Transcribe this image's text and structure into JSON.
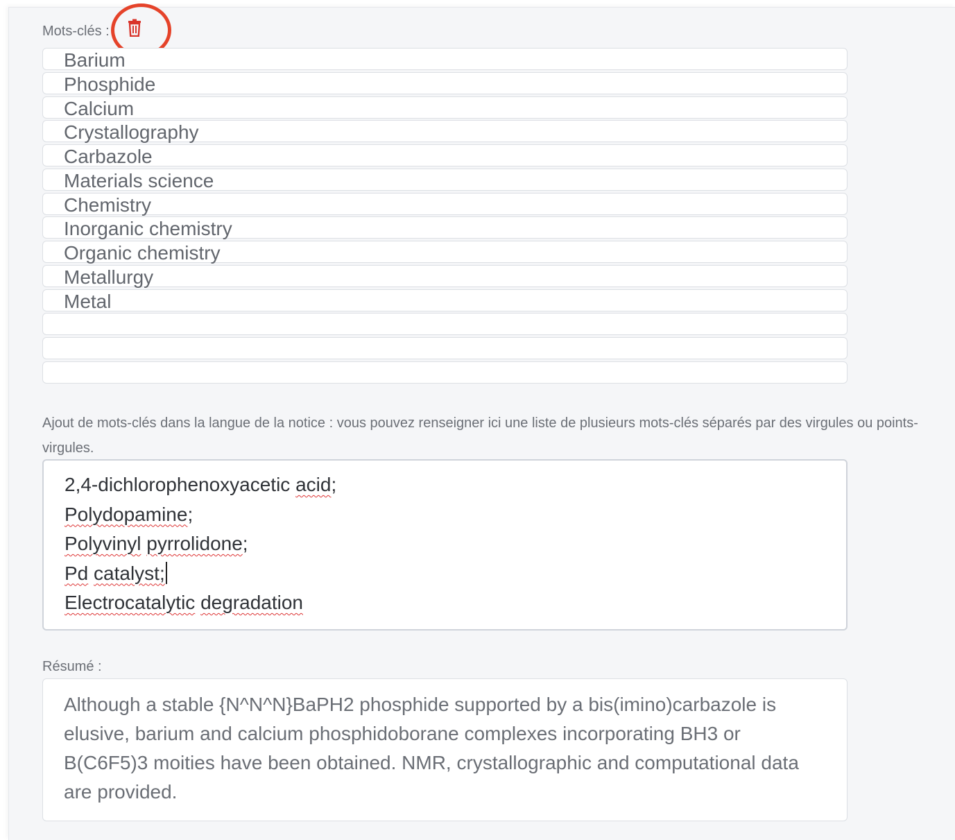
{
  "keywords": {
    "label": "Mots-clés :",
    "delete_icon": "trash-icon",
    "items": [
      "Barium",
      "Phosphide",
      "Calcium",
      "Crystallography",
      "Carbazole",
      "Materials science",
      "Chemistry",
      "Inorganic chemistry",
      "Organic chemistry",
      "Metallurgy",
      "Metal",
      "",
      "",
      ""
    ]
  },
  "add_keywords": {
    "help_text": "Ajout de mots-clés dans la langue de la notice : vous pouvez renseigner ici une liste de plusieurs mots-clés séparés par des virgules ou points-virgules.",
    "lines": [
      {
        "parts": [
          {
            "text": "2,4-dichlorophenoxyacetic ",
            "spell": false
          },
          {
            "text": "acid",
            "spell": true
          },
          {
            "text": ";",
            "spell": false
          }
        ]
      },
      {
        "parts": [
          {
            "text": "Polydopamine",
            "spell": true
          },
          {
            "text": ";",
            "spell": false
          }
        ]
      },
      {
        "parts": [
          {
            "text": "Polyvinyl",
            "spell": true
          },
          {
            "text": " ",
            "spell": false
          },
          {
            "text": "pyrrolidone",
            "spell": true
          },
          {
            "text": ";",
            "spell": false
          }
        ]
      },
      {
        "parts": [
          {
            "text": "Pd",
            "spell": true
          },
          {
            "text": " ",
            "spell": false
          },
          {
            "text": "catalyst;",
            "spell": true
          }
        ],
        "caret": true
      },
      {
        "parts": [
          {
            "text": "Electrocatalytic",
            "spell": true
          },
          {
            "text": " ",
            "spell": false
          },
          {
            "text": "degradation",
            "spell": true
          }
        ]
      }
    ]
  },
  "resume": {
    "label": "Résumé :",
    "text": "Although a stable {N^N^N}BaPH2 phosphide supported by a bis(imino)carbazole is elusive, barium and calcium phosphidoborane complexes incorporating BH3 or B(C6F5)3 moities have been obtained. NMR, crystallographic and computational data are provided."
  },
  "colors": {
    "annotation_circle": "#e5432a",
    "trash_icon": "#d9342b",
    "spellcheck": "#dd3333"
  }
}
